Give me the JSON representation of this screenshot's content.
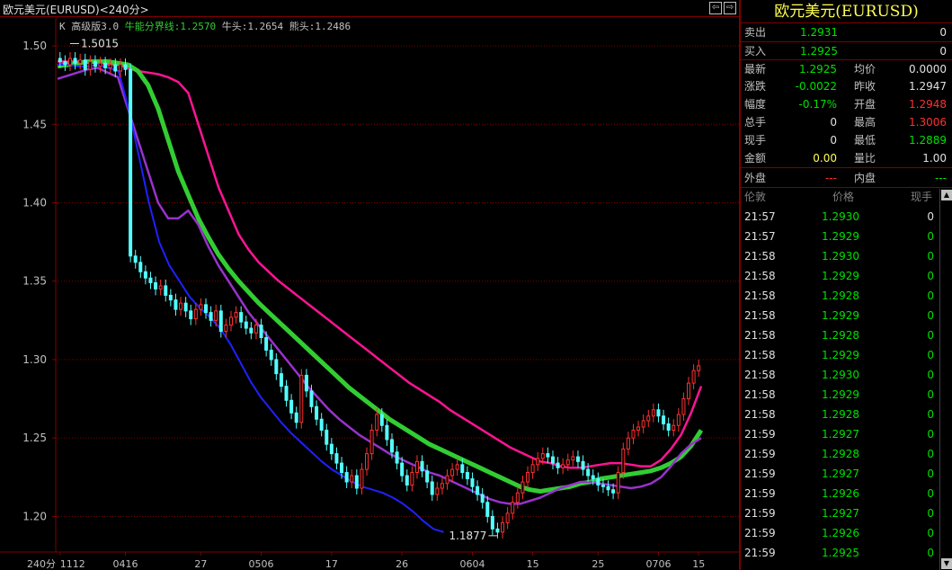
{
  "title": "欧元美元(EURUSD)<240分>",
  "indicator": {
    "name": "K",
    "version": "高级版3.0",
    "split_label": "牛能分界线:",
    "split_value": "1.2570",
    "bull_label": "牛头:",
    "bull_value": "1.2654",
    "bear_label": "熊头:",
    "bear_value": "1.2486"
  },
  "chart_data": {
    "type": "candlestick",
    "y_ticks": [
      "1.50",
      "1.45",
      "1.40",
      "1.35",
      "1.30",
      "1.25",
      "1.20"
    ],
    "ylim": [
      1.1773,
      1.5178
    ],
    "x_label_left": "240分",
    "x_ticks": [
      "1112",
      "0416",
      "27",
      "0506",
      "17",
      "26",
      "0604",
      "15",
      "25",
      "0706",
      "15"
    ],
    "high_label": "1.5015",
    "low_label": "1.1877",
    "candles_close": [
      1.49,
      1.488,
      1.492,
      1.489,
      1.491,
      1.485,
      1.49,
      1.487,
      1.489,
      1.486,
      1.488,
      1.484,
      1.488,
      1.485,
      1.366,
      1.362,
      1.356,
      1.352,
      1.349,
      1.345,
      1.347,
      1.341,
      1.338,
      1.332,
      1.336,
      1.331,
      1.326,
      1.332,
      1.335,
      1.33,
      1.325,
      1.331,
      1.318,
      1.322,
      1.327,
      1.33,
      1.324,
      1.32,
      1.317,
      1.322,
      1.314,
      1.306,
      1.3,
      1.291,
      1.283,
      1.274,
      1.266,
      1.26,
      1.29,
      1.28,
      1.27,
      1.262,
      1.255,
      1.246,
      1.24,
      1.234,
      1.228,
      1.222,
      1.226,
      1.218,
      1.23,
      1.24,
      1.255,
      1.265,
      1.258,
      1.249,
      1.241,
      1.234,
      1.226,
      1.22,
      1.228,
      1.235,
      1.229,
      1.222,
      1.214,
      1.218,
      1.221,
      1.226,
      1.23,
      1.233,
      1.228,
      1.224,
      1.219,
      1.214,
      1.209,
      1.2,
      1.192,
      1.19,
      1.196,
      1.202,
      1.209,
      1.215,
      1.222,
      1.228,
      1.233,
      1.237,
      1.24,
      1.238,
      1.234,
      1.231,
      1.233,
      1.236,
      1.238,
      1.235,
      1.23,
      1.226,
      1.224,
      1.22,
      1.219,
      1.217,
      1.215,
      1.228,
      1.243,
      1.25,
      1.255,
      1.257,
      1.261,
      1.264,
      1.268,
      1.264,
      1.259,
      1.255,
      1.258,
      1.265,
      1.275,
      1.285,
      1.293,
      1.296
    ],
    "lines": [
      {
        "color": "#ff1493",
        "values": [
          1.49,
          1.49,
          1.49,
          1.49,
          1.49,
          1.488,
          1.488,
          1.486,
          1.484,
          1.483,
          1.482,
          1.48,
          1.477,
          1.47,
          1.45,
          1.43,
          1.41,
          1.395,
          1.38,
          1.37,
          1.362,
          1.356,
          1.35,
          1.345,
          1.34,
          1.335,
          1.33,
          1.325,
          1.32,
          1.315,
          1.31,
          1.305,
          1.3,
          1.295,
          1.29,
          1.285,
          1.281,
          1.277,
          1.273,
          1.268,
          1.264,
          1.26,
          1.256,
          1.252,
          1.248,
          1.244,
          1.241,
          1.238,
          1.235,
          1.234,
          1.232,
          1.231,
          1.231,
          1.232,
          1.233,
          1.234,
          1.234,
          1.233,
          1.232,
          1.232,
          1.236,
          1.243,
          1.252,
          1.266,
          1.283
        ]
      },
      {
        "color": "#32cd32",
        "values": [
          1.487,
          1.488,
          1.489,
          1.49,
          1.49,
          1.49,
          1.489,
          1.488,
          1.484,
          1.475,
          1.46,
          1.44,
          1.42,
          1.405,
          1.39,
          1.378,
          1.367,
          1.358,
          1.35,
          1.343,
          1.336,
          1.33,
          1.324,
          1.318,
          1.312,
          1.306,
          1.3,
          1.294,
          1.288,
          1.282,
          1.277,
          1.272,
          1.267,
          1.262,
          1.258,
          1.254,
          1.25,
          1.246,
          1.243,
          1.24,
          1.237,
          1.234,
          1.231,
          1.228,
          1.225,
          1.222,
          1.219,
          1.217,
          1.216,
          1.217,
          1.218,
          1.219,
          1.221,
          1.222,
          1.224,
          1.225,
          1.226,
          1.227,
          1.228,
          1.229,
          1.231,
          1.234,
          1.238,
          1.245,
          1.255
        ]
      },
      {
        "color": "#9932cc",
        "values": [
          1.479,
          1.481,
          1.483,
          1.485,
          1.486,
          1.483,
          1.48,
          1.46,
          1.44,
          1.42,
          1.4,
          1.39,
          1.39,
          1.395,
          1.386,
          1.372,
          1.36,
          1.35,
          1.34,
          1.33,
          1.322,
          1.314,
          1.306,
          1.298,
          1.29,
          1.282,
          1.275,
          1.268,
          1.262,
          1.257,
          1.252,
          1.248,
          1.244,
          1.24,
          1.237,
          1.234,
          1.231,
          1.228,
          1.226,
          1.223,
          1.22,
          1.217,
          1.214,
          1.211,
          1.209,
          1.208,
          1.208,
          1.21,
          1.212,
          1.215,
          1.218,
          1.22,
          1.222,
          1.222,
          1.221,
          1.22,
          1.219,
          1.218,
          1.219,
          1.221,
          1.225,
          1.232,
          1.24,
          1.246,
          1.25
        ]
      },
      {
        "color": "#2020ff",
        "values": [
          1.488,
          1.488,
          1.487,
          1.487,
          1.488,
          1.486,
          1.484,
          1.46,
          1.43,
          1.4,
          1.375,
          1.36,
          1.35,
          1.34,
          1.333,
          1.327,
          1.32,
          1.31,
          1.298,
          1.286,
          1.276,
          1.268,
          1.26,
          1.253,
          1.247,
          1.241,
          1.235,
          1.23,
          1.226,
          1.222,
          1.219,
          1.217,
          1.215,
          1.212,
          1.208,
          1.203,
          1.197,
          1.192,
          1.19
        ]
      }
    ]
  },
  "quote": {
    "sell_label": "卖出",
    "sell_price": "1.2931",
    "sell_vol": "0",
    "buy_label": "买入",
    "buy_price": "1.2925",
    "buy_vol": "0",
    "latest_label": "最新",
    "latest": "1.2925",
    "avg_label": "均价",
    "avg": "0.0000",
    "change_label": "涨跌",
    "change": "-0.0022",
    "prev_label": "昨收",
    "prev": "1.2947",
    "pct_label": "幅度",
    "pct": "-0.17%",
    "open_label": "开盘",
    "open": "1.2948",
    "total_label": "总手",
    "total": "0",
    "high_label": "最高",
    "high": "1.3006",
    "cur_label": "现手",
    "cur": "0",
    "low_label": "最低",
    "low": "1.2889",
    "amount_label": "金额",
    "amount": "0.00",
    "ratio_label": "量比",
    "ratio": "1.00",
    "outer_label": "外盘",
    "outer": "---",
    "inner_label": "内盘",
    "inner": "---"
  },
  "ticks_header": {
    "time": "伦敦",
    "price": "价格",
    "vol": "现手"
  },
  "ticks": [
    {
      "time": "21:57",
      "price": "1.2930",
      "vol": "0"
    },
    {
      "time": "21:57",
      "price": "1.2929",
      "vol": "0"
    },
    {
      "time": "21:58",
      "price": "1.2930",
      "vol": "0"
    },
    {
      "time": "21:58",
      "price": "1.2929",
      "vol": "0"
    },
    {
      "time": "21:58",
      "price": "1.2928",
      "vol": "0"
    },
    {
      "time": "21:58",
      "price": "1.2929",
      "vol": "0"
    },
    {
      "time": "21:58",
      "price": "1.2928",
      "vol": "0"
    },
    {
      "time": "21:58",
      "price": "1.2929",
      "vol": "0"
    },
    {
      "time": "21:58",
      "price": "1.2930",
      "vol": "0"
    },
    {
      "time": "21:58",
      "price": "1.2929",
      "vol": "0"
    },
    {
      "time": "21:58",
      "price": "1.2928",
      "vol": "0"
    },
    {
      "time": "21:59",
      "price": "1.2927",
      "vol": "0"
    },
    {
      "time": "21:59",
      "price": "1.2928",
      "vol": "0"
    },
    {
      "time": "21:59",
      "price": "1.2927",
      "vol": "0"
    },
    {
      "time": "21:59",
      "price": "1.2926",
      "vol": "0"
    },
    {
      "time": "21:59",
      "price": "1.2927",
      "vol": "0"
    },
    {
      "time": "21:59",
      "price": "1.2926",
      "vol": "0"
    },
    {
      "time": "21:59",
      "price": "1.2925",
      "vol": "0"
    }
  ],
  "colors": {
    "up": "#ff3030",
    "down": "#54ffff",
    "neutral": "#e0e0e0",
    "green": "#00e000",
    "grid": "#800000",
    "title": "#ffff54"
  }
}
